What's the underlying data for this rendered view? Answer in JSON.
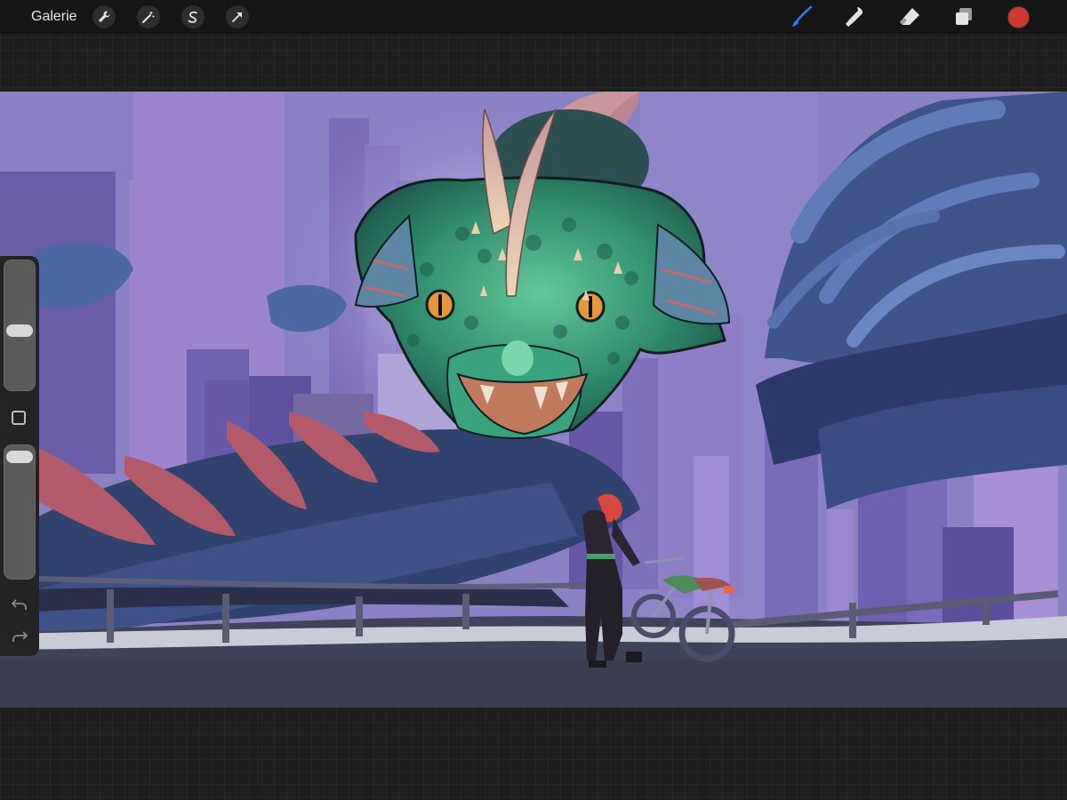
{
  "app": {
    "gallery_label": "Galerie"
  },
  "toolbar": {
    "left_tools": [
      {
        "name": "wrench-icon"
      },
      {
        "name": "magic-wand-icon"
      },
      {
        "name": "selection-icon"
      },
      {
        "name": "transform-arrow-icon"
      }
    ],
    "right_tools": [
      {
        "name": "brush-icon",
        "active": true,
        "color": "#2f7cf6"
      },
      {
        "name": "smudge-icon"
      },
      {
        "name": "eraser-icon"
      },
      {
        "name": "layers-icon"
      }
    ],
    "current_color": "#cf3a30"
  },
  "sidebar": {
    "brush_size_level": 0.45,
    "opacity_level": 0.03
  },
  "colors": {
    "accent": "#2f7cf6",
    "canvas_bg": "#8a7fc0"
  }
}
